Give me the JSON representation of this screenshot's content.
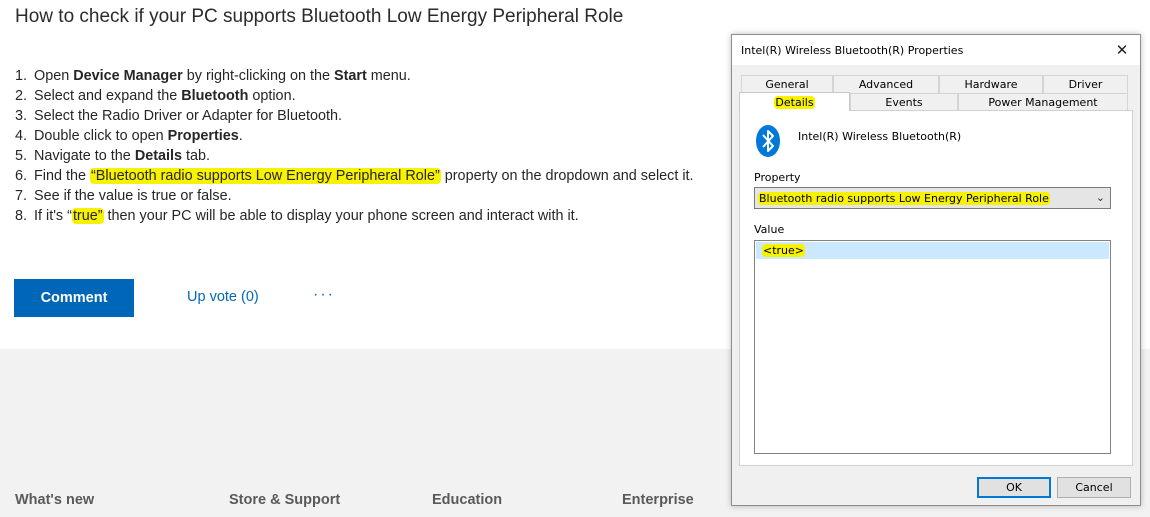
{
  "article": {
    "title": "How to check if your PC supports Bluetooth Low Energy Peripheral Role",
    "steps": [
      {
        "num": "1.",
        "parts": [
          {
            "t": "Open "
          },
          {
            "t": "Device Manager",
            "b": true
          },
          {
            "t": " by right-clicking on the "
          },
          {
            "t": "Start",
            "b": true
          },
          {
            "t": " menu."
          }
        ]
      },
      {
        "num": "2.",
        "parts": [
          {
            "t": "Select and expand the "
          },
          {
            "t": "Bluetooth",
            "b": true
          },
          {
            "t": " option."
          }
        ]
      },
      {
        "num": "3.",
        "parts": [
          {
            "t": "Select the Radio Driver or Adapter for Bluetooth."
          }
        ]
      },
      {
        "num": "4.",
        "parts": [
          {
            "t": "Double click to open "
          },
          {
            "t": "Properties",
            "b": true
          },
          {
            "t": "."
          }
        ]
      },
      {
        "num": "5.",
        "parts": [
          {
            "t": "Navigate to the "
          },
          {
            "t": "Details",
            "b": true
          },
          {
            "t": " tab."
          }
        ]
      },
      {
        "num": "6.",
        "parts": [
          {
            "t": "Find the "
          },
          {
            "t": "“Bluetooth radio supports Low Energy Peripheral Role”",
            "h": true
          },
          {
            "t": " property on the dropdown and select it."
          }
        ]
      },
      {
        "num": "7.",
        "parts": [
          {
            "t": "See if the value is true or false."
          }
        ]
      },
      {
        "num": "8.",
        "parts": [
          {
            "t": "If it's “"
          },
          {
            "t": "true”",
            "h": true
          },
          {
            "t": " then your PC will be able to display your phone screen and interact with it."
          }
        ]
      }
    ],
    "comment_label": "Comment",
    "upvote_label": "Up vote (0)",
    "more_label": "···"
  },
  "footer": {
    "links": [
      "What's new",
      "Store & Support",
      "Education",
      "Enterprise"
    ]
  },
  "dialog": {
    "title": "Intel(R) Wireless Bluetooth(R) Properties",
    "close_glyph": "✕",
    "tabs_row1": [
      "General",
      "Advanced",
      "Hardware",
      "Driver"
    ],
    "tabs_row2": [
      "Details",
      "Events",
      "Power Management"
    ],
    "active_tab": "Details",
    "device_name": "Intel(R) Wireless Bluetooth(R)",
    "property_label": "Property",
    "property_value": "Bluetooth radio supports Low Energy Peripheral Role",
    "value_label": "Value",
    "value_item": "<true>",
    "ok_label": "OK",
    "cancel_label": "Cancel"
  },
  "colors": {
    "accent": "#0067b8",
    "highlight": "#f7f200",
    "selection": "#cce8ff",
    "footer_bg": "#f2f2f2",
    "bluetooth": "#0078d7"
  },
  "icons": {
    "close": "close-icon",
    "bluetooth": "bluetooth-icon",
    "dropdown": "chevron-down-icon"
  }
}
